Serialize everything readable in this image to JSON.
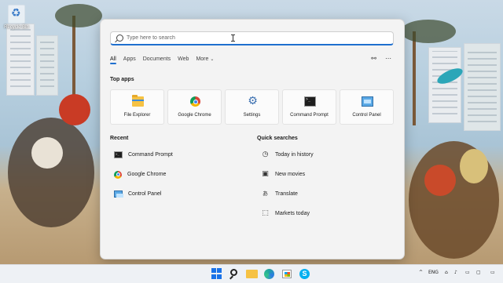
{
  "desktop": {
    "recycle_bin_label": "Recycle Bin"
  },
  "start_menu": {
    "search": {
      "placeholder": "Type here to search",
      "value": ""
    },
    "tabs": [
      {
        "label": "All",
        "active": true
      },
      {
        "label": "Apps"
      },
      {
        "label": "Documents"
      },
      {
        "label": "Web"
      },
      {
        "label": "More",
        "icon": "chevron-down-icon"
      }
    ],
    "top_right_icons": [
      "share-network-icon",
      "more-ellipsis-icon"
    ],
    "top_apps_title": "Top apps",
    "top_apps": [
      {
        "label": "File Explorer",
        "icon": "file-explorer-icon"
      },
      {
        "label": "Google Chrome",
        "icon": "chrome-icon"
      },
      {
        "label": "Settings",
        "icon": "settings-gear-icon"
      },
      {
        "label": "Command Prompt",
        "icon": "command-prompt-icon"
      },
      {
        "label": "Control Panel",
        "icon": "control-panel-icon"
      }
    ],
    "recent_title": "Recent",
    "recent": [
      {
        "label": "Command Prompt",
        "icon": "command-prompt-icon"
      },
      {
        "label": "Google Chrome",
        "icon": "chrome-icon"
      },
      {
        "label": "Control Panel",
        "icon": "control-panel-icon"
      }
    ],
    "quick_title": "Quick searches",
    "quick": [
      {
        "label": "Today in history",
        "icon": "clock-icon"
      },
      {
        "label": "New movies",
        "icon": "film-icon"
      },
      {
        "label": "Translate",
        "icon": "translate-icon"
      },
      {
        "label": "Markets today",
        "icon": "chart-icon"
      }
    ]
  },
  "taskbar": {
    "apps": [
      "windows-start-icon",
      "search-icon",
      "file-explorer-icon",
      "edge-icon",
      "store-icon",
      "skype-icon"
    ],
    "skype_letter": "S",
    "tray": {
      "chevron": "^",
      "language": "ENG",
      "show_desktop": "▭"
    }
  },
  "colors": {
    "accent": "#1f6fcf",
    "start_bg": "#f3f3f3",
    "taskbar_bg": "#eef1f5"
  }
}
